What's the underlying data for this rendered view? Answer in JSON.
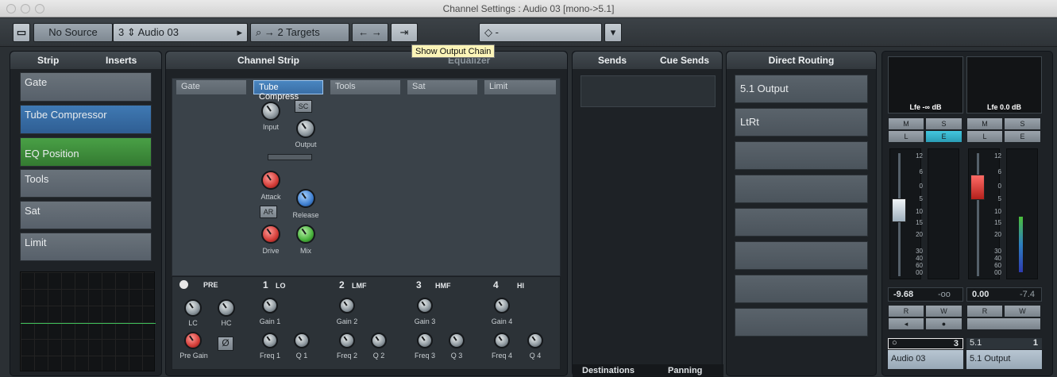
{
  "window": {
    "title": "Channel Settings : Audio 03 [mono->5.1]"
  },
  "toolbar": {
    "no_source": "No Source",
    "channel_num": "3",
    "channel_name": "Audio 03",
    "targets": "→ 2 Targets",
    "preset": "◇ -",
    "tooltip": "Show Output Chain"
  },
  "strip_tab": {
    "strip": "Strip",
    "inserts": "Inserts"
  },
  "strip_slots": [
    "Gate",
    "Tube Compressor",
    "EQ Position",
    "Tools",
    "Sat",
    "Limit"
  ],
  "channel_strip": {
    "title": "Channel Strip",
    "equalizer": "Equalizer",
    "columns": [
      "Gate",
      "Tube Compress",
      "Tools",
      "Sat",
      "Limit"
    ]
  },
  "comp": {
    "sc": "SC",
    "ar": "AR",
    "input": "Input",
    "output": "Output",
    "attack": "Attack",
    "release": "Release",
    "drive": "Drive",
    "mix": "Mix"
  },
  "eq": {
    "pre": "PRE",
    "b1": "1",
    "b1t": "LO",
    "b2": "2",
    "b2t": "LMF",
    "b3": "3",
    "b3t": "HMF",
    "b4": "4",
    "b4t": "HI",
    "lc": "LC",
    "hc": "HC",
    "pre_gain": "Pre Gain",
    "phase": "Ø",
    "g1": "Gain 1",
    "g2": "Gain 2",
    "g3": "Gain 3",
    "g4": "Gain 4",
    "f1": "Freq 1",
    "f2": "Freq 2",
    "f3": "Freq 3",
    "f4": "Freq 4",
    "q1": "Q 1",
    "q2": "Q 2",
    "q3": "Q 3",
    "q4": "Q 4"
  },
  "sends": {
    "sends": "Sends",
    "cue": "Cue Sends",
    "destinations": "Destinations",
    "panning": "Panning"
  },
  "routing": {
    "title": "Direct Routing",
    "items": [
      "5.1 Output",
      "LtRt"
    ]
  },
  "meters": {
    "lfe1": "Lfe -∞ dB",
    "lfe2": "Lfe 0.0 dB",
    "m": "M",
    "s": "S",
    "l": "L",
    "e": "E",
    "r": "R",
    "w": "W",
    "scale": [
      "12",
      "6",
      "0",
      "5",
      "10",
      "15",
      "20",
      "30",
      "40",
      "60",
      "00"
    ],
    "v1": "-9.68",
    "v2": "-oo",
    "v3": "0.00",
    "v4": "-7.4",
    "ch_num": "3",
    "ch_name": "Audio 03",
    "out_num": "5.1",
    "out_idx": "1",
    "out_name": "5.1 Output"
  },
  "colors": {
    "blue_slot": "#3f79b3",
    "green_slot": "#49a046",
    "teal": "#2b9cb5"
  }
}
